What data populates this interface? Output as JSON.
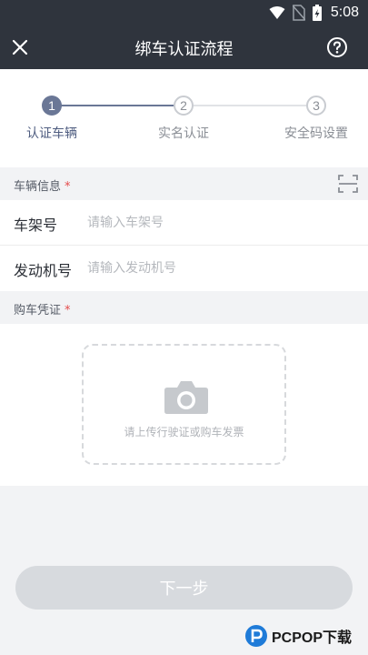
{
  "status_bar": {
    "time": "5:08",
    "icons": [
      "wifi-icon",
      "no-sim-icon",
      "battery-charging-icon"
    ]
  },
  "header": {
    "title": "绑车认证流程",
    "close_icon": "close-icon",
    "help_icon": "help-icon"
  },
  "steps": [
    {
      "number": "1",
      "label": "认证车辆",
      "active": true
    },
    {
      "number": "2",
      "label": "实名认证",
      "active": false
    },
    {
      "number": "3",
      "label": "安全码设置",
      "active": false
    }
  ],
  "vehicle_section": {
    "title": "车辆信息",
    "required_mark": "*",
    "scan_icon": "scan-icon",
    "fields": [
      {
        "label": "车架号",
        "placeholder": "请输入车架号",
        "value": ""
      },
      {
        "label": "发动机号",
        "placeholder": "请输入发动机号",
        "value": ""
      }
    ]
  },
  "purchase_section": {
    "title": "购车凭证",
    "required_mark": "*",
    "upload_hint": "请上传行驶证或购车发票",
    "camera_icon": "camera-icon"
  },
  "next_button": {
    "label": "下一步"
  },
  "watermark": {
    "text": "PCPOP下载"
  },
  "colors": {
    "header_bg": "#2f343d",
    "step_active": "#6a7796",
    "step_inactive": "#c9ccd1",
    "button_disabled": "#d7dade",
    "required": "#e54b4b"
  }
}
